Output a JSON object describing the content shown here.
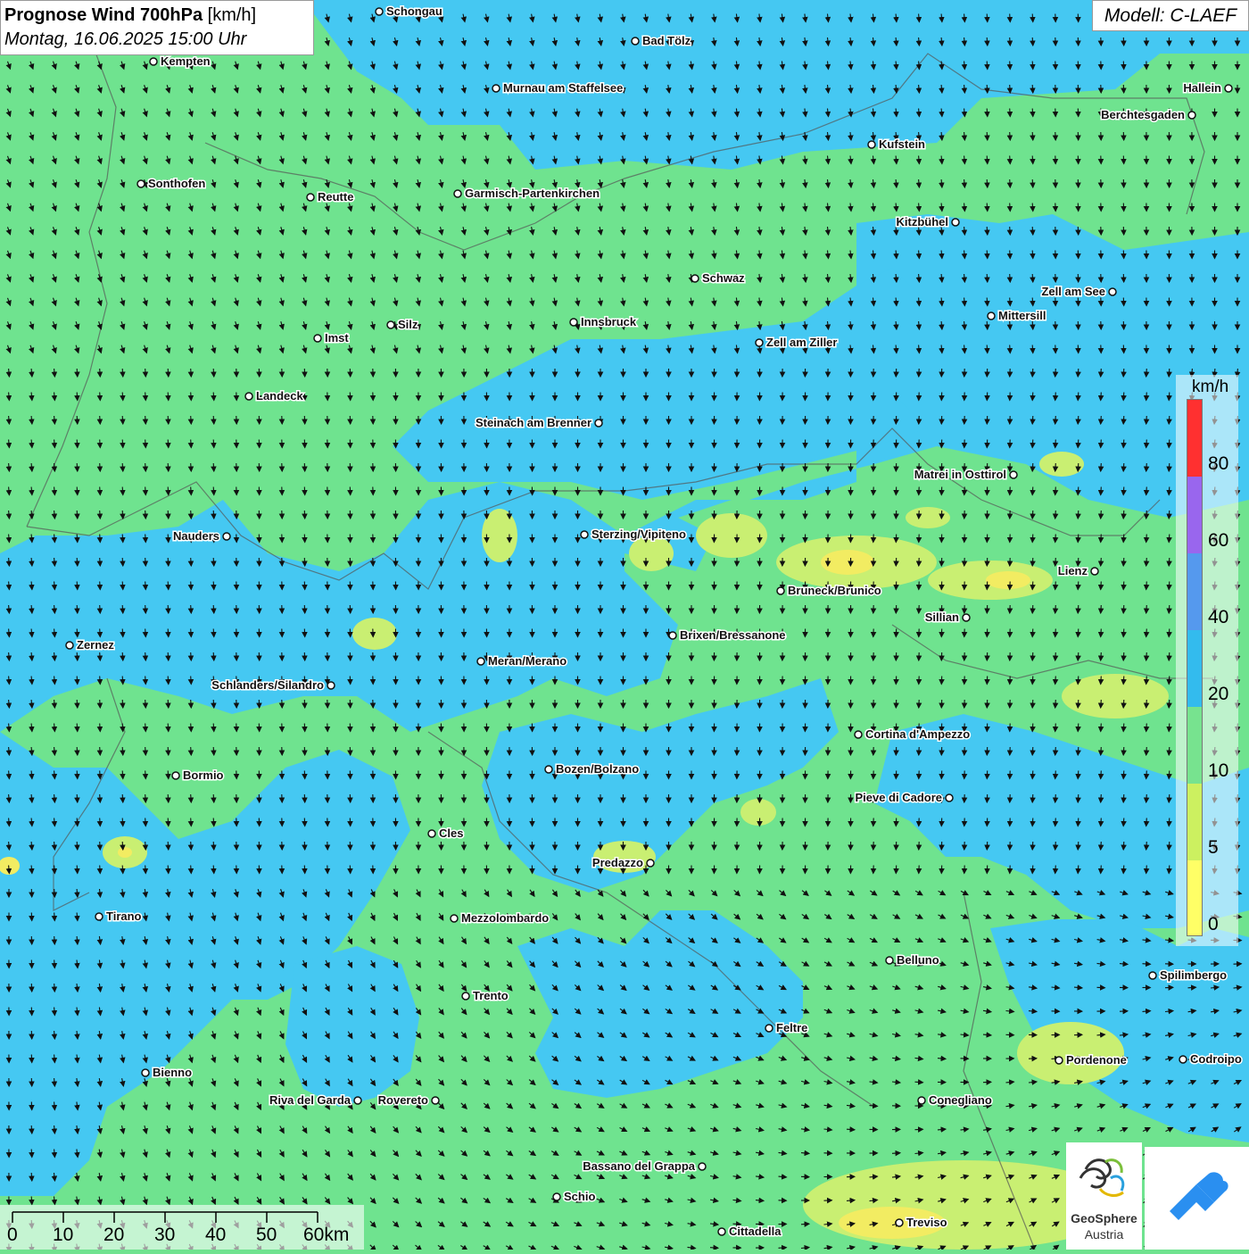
{
  "title": {
    "main": "Prognose Wind 700hPa",
    "unit": "[km/h]",
    "datetime": "Montag, 16.06.2025 15:00 Uhr"
  },
  "model": "Modell: C-LAEF",
  "legend": {
    "unit": "km/h",
    "labels": [
      "80",
      "60",
      "40",
      "20",
      "10",
      "5",
      "0"
    ],
    "colors": [
      "#ff3030",
      "#9966ee",
      "#5599ee",
      "#33bbee",
      "#77e38f",
      "#ccf060",
      "#ffff66"
    ]
  },
  "scalebar": {
    "labels": [
      "0",
      "10",
      "20",
      "30",
      "40",
      "50",
      "60km"
    ]
  },
  "logos": {
    "geosphere_name": "GeoSphere",
    "geosphere_sub": "Austria"
  },
  "colors": {
    "calm_yellow": "#f2ec62",
    "light_green": "#c9ef72",
    "green": "#6fe38f",
    "cyan": "#45c8f2"
  },
  "cities": [
    {
      "name": "Schongau"
    },
    {
      "name": "Bad Tölz"
    },
    {
      "name": "Kempten"
    },
    {
      "name": "Murnau am Staffelsee"
    },
    {
      "name": "Hallein"
    },
    {
      "name": "Berchtesgaden"
    },
    {
      "name": "Kufstein"
    },
    {
      "name": "Sonthofen"
    },
    {
      "name": "Reutte"
    },
    {
      "name": "Garmisch-Partenkirchen"
    },
    {
      "name": "Kitzbühel"
    },
    {
      "name": "Schwaz"
    },
    {
      "name": "Zell am See"
    },
    {
      "name": "Mittersill"
    },
    {
      "name": "Innsbruck"
    },
    {
      "name": "Silz"
    },
    {
      "name": "Imst"
    },
    {
      "name": "Zell am Ziller"
    },
    {
      "name": "Landeck"
    },
    {
      "name": "Steinach am Brenner"
    },
    {
      "name": "Matrei in Osttirol"
    },
    {
      "name": "Nauders"
    },
    {
      "name": "Sterzing/Vipiteno"
    },
    {
      "name": "Lienz"
    },
    {
      "name": "Bruneck/Brunico"
    },
    {
      "name": "Sillian"
    },
    {
      "name": "Brixen/Bressanone"
    },
    {
      "name": "Zernez"
    },
    {
      "name": "Meran/Merano"
    },
    {
      "name": "Schlanders/Silandro"
    },
    {
      "name": "Cortina d'Ampezzo"
    },
    {
      "name": "Bormio"
    },
    {
      "name": "Bozen/Bolzano"
    },
    {
      "name": "Pieve di Cadore"
    },
    {
      "name": "Cles"
    },
    {
      "name": "Predazzo"
    },
    {
      "name": "Tirano"
    },
    {
      "name": "Mezzolombardo"
    },
    {
      "name": "Belluno"
    },
    {
      "name": "Spilimbergo"
    },
    {
      "name": "Trento"
    },
    {
      "name": "Feltre"
    },
    {
      "name": "Pordenone"
    },
    {
      "name": "Codroipo"
    },
    {
      "name": "Bienno"
    },
    {
      "name": "Riva del Garda"
    },
    {
      "name": "Rovereto"
    },
    {
      "name": "Conegliano"
    },
    {
      "name": "Bassano del Grappa"
    },
    {
      "name": "Schio"
    },
    {
      "name": "Treviso"
    },
    {
      "name": "Cittadella"
    }
  ]
}
